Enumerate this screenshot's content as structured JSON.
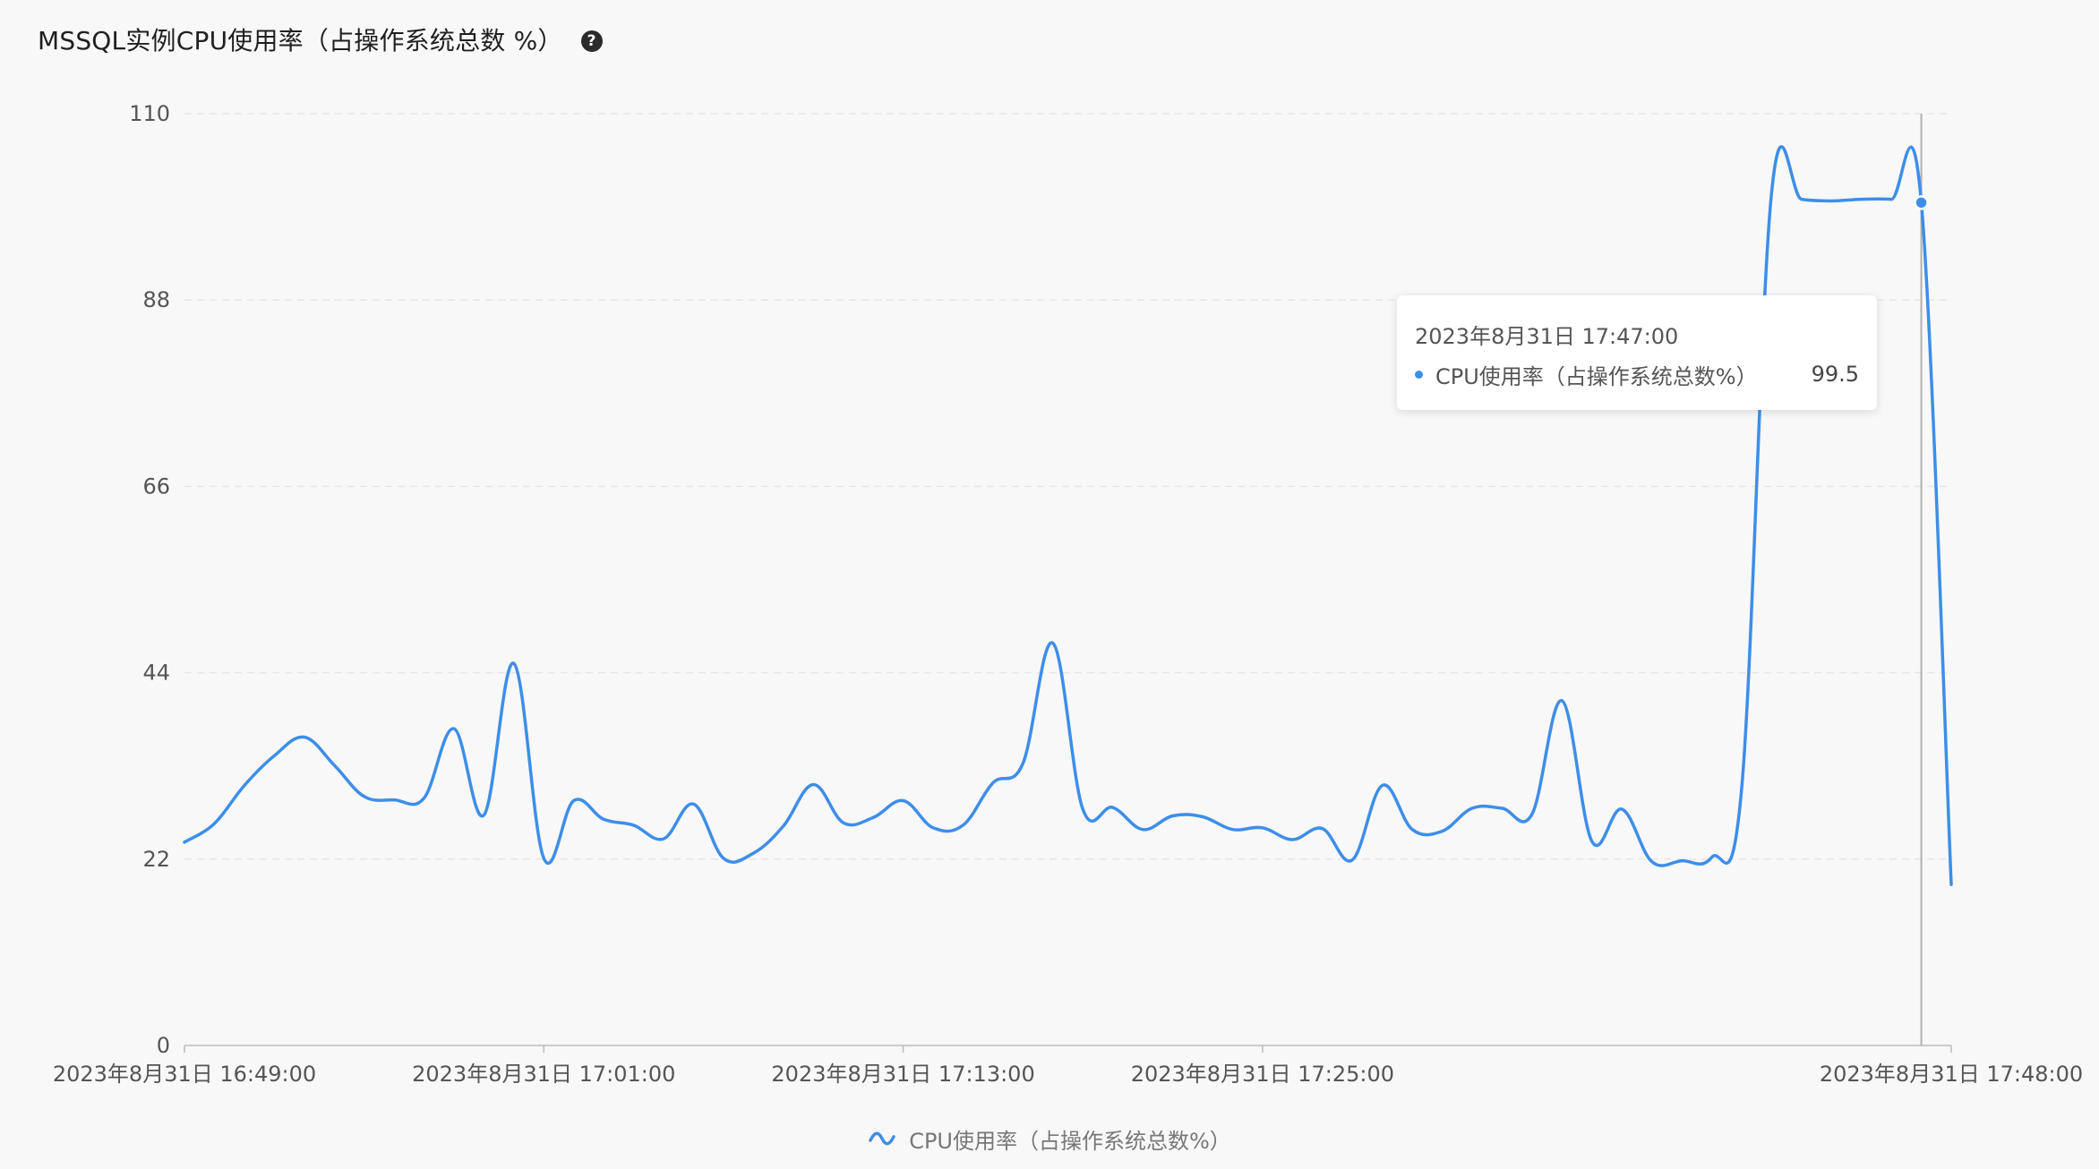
{
  "panel": {
    "title": "MSSQL实例CPU使用率（占操作系统总数 %）",
    "help_glyph": "?"
  },
  "tooltip": {
    "time": "2023年8月31日 17:47:00",
    "series_name": "CPU使用率（占操作系统总数%）",
    "value": "99.5"
  },
  "legend": {
    "label": "CPU使用率（占操作系统总数%）"
  },
  "colors": {
    "line": "#3d8ee8",
    "grid": "#e6e6e6",
    "axis": "#bbbbbb",
    "crosshair": "#b0b0b0",
    "background": "#f8f8f8"
  },
  "chart_data": {
    "type": "line",
    "title": "MSSQL实例CPU使用率（占操作系统总数 %）",
    "xlabel": "",
    "ylabel": "",
    "y_ticks": [
      0,
      22,
      44,
      66,
      88,
      110
    ],
    "ylim": [
      0,
      110
    ],
    "x_range": [
      "2023年8月31日 16:49:00",
      "2023年8月31日 17:48:00"
    ],
    "x_ticks": [
      {
        "minute": 0,
        "label": "2023年8月31日 16:49:00"
      },
      {
        "minute": 12,
        "label": "2023年8月31日 17:01:00"
      },
      {
        "minute": 24,
        "label": "2023年8月31日 17:13:00"
      },
      {
        "minute": 36,
        "label": "2023年8月31日 17:25:00"
      },
      {
        "minute": 59,
        "label": "2023年8月31日 17:48:00"
      }
    ],
    "grid": true,
    "legend_position": "bottom-center",
    "highlight": {
      "minute": 58,
      "value": 99.5
    },
    "series": [
      {
        "name": "CPU使用率（占操作系统总数%）",
        "minutes": [
          0,
          1,
          2,
          3,
          4,
          5,
          6,
          7,
          8,
          9,
          10,
          11,
          12,
          13,
          14,
          15,
          16,
          17,
          18,
          19,
          20,
          21,
          22,
          23,
          24,
          25,
          26,
          27,
          28,
          29,
          30,
          31,
          32,
          33,
          34,
          35,
          36,
          37,
          38,
          39,
          40,
          41,
          42,
          43,
          44,
          45,
          46,
          47,
          48,
          49,
          50,
          51,
          52,
          53,
          54,
          55,
          56,
          57,
          58,
          59
        ],
        "values": [
          24.0,
          26.2,
          30.7,
          34.2,
          36.4,
          33.1,
          29.4,
          29.0,
          29.2,
          37.4,
          27.2,
          45.1,
          22.1,
          28.9,
          26.7,
          26.0,
          24.4,
          28.5,
          22.1,
          22.7,
          25.9,
          30.8,
          26.3,
          26.9,
          28.9,
          25.7,
          26.0,
          31.0,
          33.3,
          47.5,
          27.9,
          28.1,
          25.5,
          27.1,
          27.0,
          25.5,
          25.7,
          24.3,
          25.6,
          21.9,
          30.7,
          25.5,
          25.3,
          28.0,
          28.0,
          27.3,
          40.7,
          24.1,
          27.9,
          21.7,
          21.8,
          22.2,
          30.3,
          100.7,
          99.9,
          99.7,
          99.9,
          99.9,
          99.5,
          19.0
        ]
      }
    ]
  }
}
